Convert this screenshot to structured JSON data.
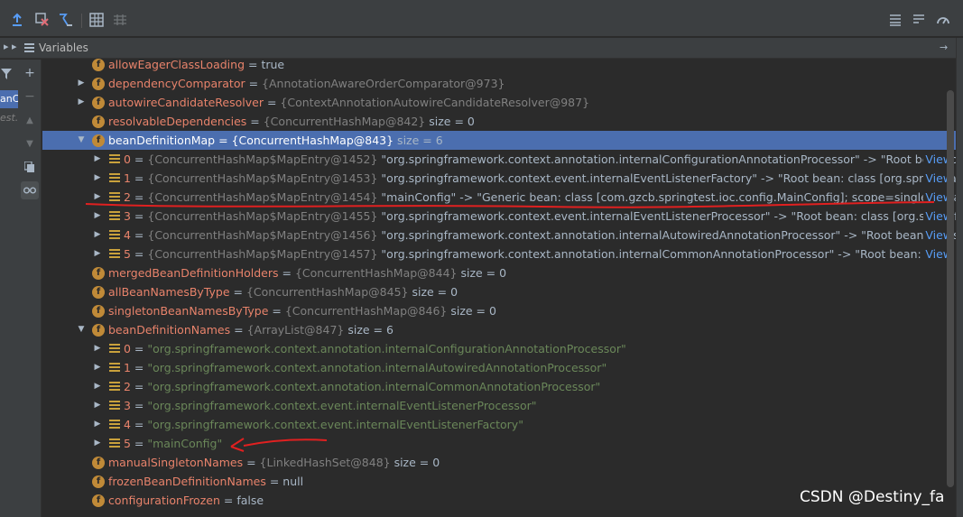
{
  "header": {
    "title": "Variables"
  },
  "left_strip": {
    "selected_label": "anCo",
    "sub_label": "est.a"
  },
  "watermark": "CSDN @Destiny_fa",
  "colors": {
    "selected_row": "#4b6eaf",
    "field_name": "#e8836b",
    "string": "#6a8759",
    "ref": "#808080",
    "link": "#589df6"
  },
  "rows": [
    {
      "name": "allowEagerClassLoading",
      "eq": " = ",
      "value": "true",
      "kind": "field",
      "arrow": ""
    },
    {
      "name": "dependencyComparator",
      "eq": " = ",
      "hash": "{AnnotationAwareOrderComparator@973}",
      "kind": "field",
      "arrow": "right"
    },
    {
      "name": "autowireCandidateResolver",
      "eq": " = ",
      "hash": "{ContextAnnotationAutowireCandidateResolver@987}",
      "kind": "field",
      "arrow": "right"
    },
    {
      "name": "resolvableDependencies",
      "eq": " = ",
      "hash": "{ConcurrentHashMap@842}",
      "value": "  size = 0",
      "kind": "field",
      "arrow": ""
    },
    {
      "name": "beanDefinitionMap",
      "eq": " = ",
      "hash": "{ConcurrentHashMap@843}",
      "value": "  size = 6",
      "kind": "field",
      "arrow": "down",
      "selected": true
    },
    {
      "name": "0",
      "eq": " = ",
      "hash": "{ConcurrentHashMap$MapEntry@1452}",
      "value": " \"org.springframework.context.annotation.internalConfigurationAnnotationProcessor\" -> \"Root bean: class ...",
      "view": "View",
      "kind": "entry",
      "arrow": "right"
    },
    {
      "name": "1",
      "eq": " = ",
      "hash": "{ConcurrentHashMap$MapEntry@1453}",
      "value": " \"org.springframework.context.event.internalEventListenerFactory\" -> \"Root bean: class [org.springframewo...",
      "view": "View",
      "kind": "entry",
      "arrow": "right"
    },
    {
      "name": "2",
      "eq": " = ",
      "hash": "{ConcurrentHashMap$MapEntry@1454}",
      "value": " \"mainConfig\" -> \"Generic bean: class [com.gzcb.springtest.ioc.config.MainConfig]; scope=singleton; abstr...",
      "view": "View",
      "kind": "entry",
      "arrow": "right"
    },
    {
      "name": "3",
      "eq": " = ",
      "hash": "{ConcurrentHashMap$MapEntry@1455}",
      "value": " \"org.springframework.context.event.internalEventListenerProcessor\" -> \"Root bean: class [org.springframe...",
      "view": "View",
      "kind": "entry",
      "arrow": "right"
    },
    {
      "name": "4",
      "eq": " = ",
      "hash": "{ConcurrentHashMap$MapEntry@1456}",
      "value": " \"org.springframework.context.annotation.internalAutowiredAnnotationProcessor\" -> \"Root bean: class [org...",
      "view": "View",
      "kind": "entry",
      "arrow": "right"
    },
    {
      "name": "5",
      "eq": " = ",
      "hash": "{ConcurrentHashMap$MapEntry@1457}",
      "value": " \"org.springframework.context.annotation.internalCommonAnnotationProcessor\" -> \"Root bean: class [org...",
      "view": "View",
      "kind": "entry",
      "arrow": "right"
    },
    {
      "name": "mergedBeanDefinitionHolders",
      "eq": " = ",
      "hash": "{ConcurrentHashMap@844}",
      "value": "  size = 0",
      "kind": "field",
      "arrow": ""
    },
    {
      "name": "allBeanNamesByType",
      "eq": " = ",
      "hash": "{ConcurrentHashMap@845}",
      "value": "  size = 0",
      "kind": "field",
      "arrow": ""
    },
    {
      "name": "singletonBeanNamesByType",
      "eq": " = ",
      "hash": "{ConcurrentHashMap@846}",
      "value": "  size = 0",
      "kind": "field",
      "arrow": ""
    },
    {
      "name": "beanDefinitionNames",
      "eq": " = ",
      "hash": "{ArrayList@847}",
      "value": "  size = 6",
      "kind": "field",
      "arrow": "down"
    },
    {
      "name": "0",
      "eq": " = ",
      "str": "\"org.springframework.context.annotation.internalConfigurationAnnotationProcessor\"",
      "kind": "entry",
      "arrow": "right"
    },
    {
      "name": "1",
      "eq": " = ",
      "str": "\"org.springframework.context.annotation.internalAutowiredAnnotationProcessor\"",
      "kind": "entry",
      "arrow": "right"
    },
    {
      "name": "2",
      "eq": " = ",
      "str": "\"org.springframework.context.annotation.internalCommonAnnotationProcessor\"",
      "kind": "entry",
      "arrow": "right"
    },
    {
      "name": "3",
      "eq": " = ",
      "str": "\"org.springframework.context.event.internalEventListenerProcessor\"",
      "kind": "entry",
      "arrow": "right"
    },
    {
      "name": "4",
      "eq": " = ",
      "str": "\"org.springframework.context.event.internalEventListenerFactory\"",
      "kind": "entry",
      "arrow": "right"
    },
    {
      "name": "5",
      "eq": " = ",
      "str": "\"mainConfig\"",
      "kind": "entry",
      "arrow": "right"
    },
    {
      "name": "manualSingletonNames",
      "eq": " = ",
      "hash": "{LinkedHashSet@848}",
      "value": "  size = 0",
      "kind": "field",
      "arrow": ""
    },
    {
      "name": "frozenBeanDefinitionNames",
      "eq": " = ",
      "value": "null",
      "kind": "field",
      "arrow": ""
    },
    {
      "name": "configurationFrozen",
      "eq": " = ",
      "value": "false",
      "kind": "field",
      "arrow": ""
    }
  ]
}
